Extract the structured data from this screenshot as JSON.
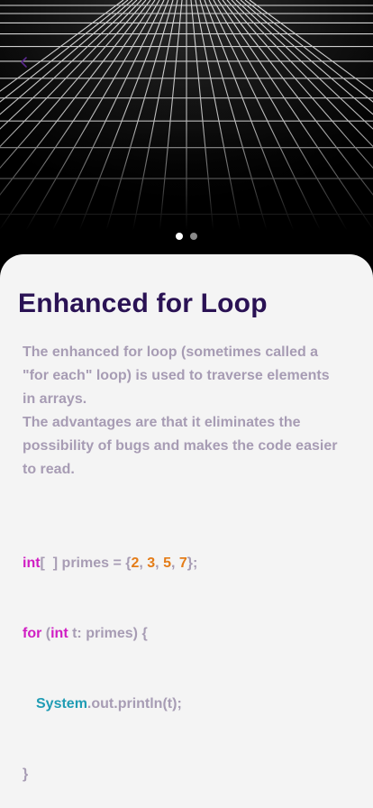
{
  "colors": {
    "background_top": "#000000",
    "sheet": "#f4f4f4",
    "title": "#2a1254",
    "body_text": "#a79cb4",
    "keyword": "#d01ec3",
    "number": "#e47c18",
    "class_name": "#1f9cb4",
    "pager_active": "#ffffff",
    "pager_inactive": "#8a8a8a",
    "back_arrow": "#5b2a8e"
  },
  "header": {
    "back_icon": "chevron-left-icon",
    "image": "perspective-grid"
  },
  "pager": {
    "count": 2,
    "active_index": 0
  },
  "lesson": {
    "title": "Enhanced for Loop",
    "paragraph_1": "The enhanced for loop (sometimes called a \"for each\" loop) is used to traverse elements in arrays.",
    "paragraph_2": "The advantages are that it eliminates the possibility of bugs and makes the code easier to read."
  },
  "code": {
    "line1": {
      "type": "int",
      "brackets": "[  ]",
      "declaration": " primes = {",
      "n1": "2",
      "n2": "3",
      "n3": "5",
      "n4": "7",
      "comma": ", ",
      "close": "};"
    },
    "line2": {
      "for_kw": "for",
      "open": " (",
      "int_kw": "int",
      "rest": " t: primes) {"
    },
    "line3": {
      "class": "System",
      "rest": ".out.println(t);"
    },
    "line4": {
      "close": "}"
    }
  }
}
